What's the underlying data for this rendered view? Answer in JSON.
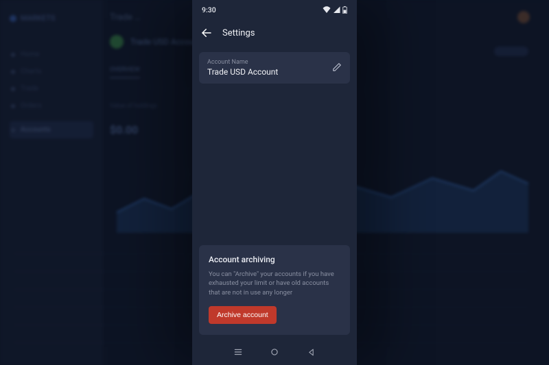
{
  "statusbar": {
    "time": "9:30"
  },
  "appbar": {
    "title": "Settings"
  },
  "account_name_field": {
    "label": "Account Name",
    "value": "Trade USD Account"
  },
  "archive_section": {
    "title": "Account archiving",
    "description": "You can \"Archive\" your accounts if you have exhausted your limit or have old accounts that are not in use any longer",
    "button_label": "Archive account"
  },
  "background": {
    "app_name": "MARKETS",
    "page_title": "Trade …",
    "account_name": "Trade USD Account",
    "sidebar": {
      "items": [
        {
          "label": "Home"
        },
        {
          "label": "Charts"
        },
        {
          "label": "Trade"
        },
        {
          "label": "Orders"
        },
        {
          "label": ""
        },
        {
          "label": "Accounts"
        }
      ]
    },
    "tabs": [
      {
        "label": "OVERVIEW",
        "active": true
      },
      {
        "label": ""
      },
      {
        "label": ""
      }
    ],
    "section_label": "Value of holdings",
    "big_value": "$0.00"
  },
  "colors": {
    "phone_bg": "#1e2639",
    "card_bg": "#2a3248",
    "accent_danger": "#c0392b",
    "text_primary": "#f0f1f5",
    "text_muted": "#8a90a2"
  }
}
